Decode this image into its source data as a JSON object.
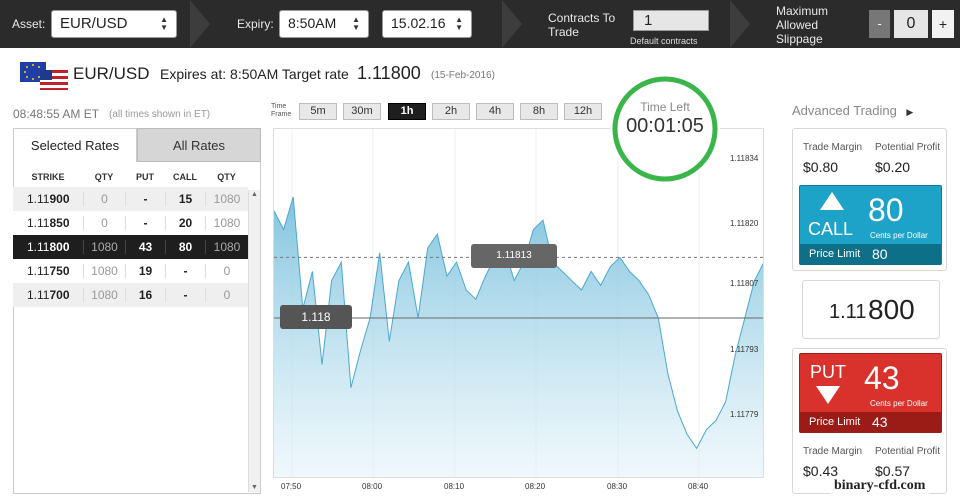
{
  "topbar": {
    "asset_label": "Asset:",
    "asset_value": "EUR/USD",
    "expiry_label": "Expiry:",
    "expiry_time": "8:50AM",
    "expiry_date": "15.02.16",
    "contracts_label_1": "Contracts To",
    "contracts_label_2": "Trade",
    "contracts_value": "1",
    "default_label": "Default contracts",
    "slippage_1": "Maximum",
    "slippage_2": "Allowed",
    "slippage_3": "Slippage",
    "minus": "-",
    "slippage_value": "0",
    "plus": "+"
  },
  "header": {
    "pair": "EUR/USD",
    "expires_text": "Expires at: 8:50AM Target rate",
    "target_rate": "1.11800",
    "date_paren": "(15-Feb-2016)",
    "clock": "08:48:55 AM ET",
    "clock_note": "(all times shown in ET)"
  },
  "timeframe": {
    "label_1": "Time",
    "label_2": "Frame",
    "buttons": [
      "5m",
      "30m",
      "1h",
      "2h",
      "4h",
      "8h",
      "12h"
    ],
    "active": "1h"
  },
  "timer": {
    "label": "Time Left",
    "value": "00:01:05"
  },
  "tabs": {
    "selected": "Selected Rates",
    "all": "All Rates"
  },
  "table": {
    "headers": [
      "STRIKE",
      "QTY",
      "PUT",
      "CALL",
      "QTY"
    ],
    "rows": [
      {
        "strike_a": "1.11",
        "strike_b": "900",
        "qty1": "0",
        "put": "-",
        "call": "15",
        "qty2": "1080"
      },
      {
        "strike_a": "1.11",
        "strike_b": "850",
        "qty1": "0",
        "put": "-",
        "call": "20",
        "qty2": "1080"
      },
      {
        "strike_a": "1.11",
        "strike_b": "800",
        "qty1": "1080",
        "put": "43",
        "call": "80",
        "qty2": "1080"
      },
      {
        "strike_a": "1.11",
        "strike_b": "750",
        "qty1": "1080",
        "put": "19",
        "call": "-",
        "qty2": "0"
      },
      {
        "strike_a": "1.11",
        "strike_b": "700",
        "qty1": "1080",
        "put": "16",
        "call": "-",
        "qty2": "0"
      }
    ]
  },
  "chart_data": {
    "type": "area",
    "x_ticks": [
      "07:50",
      "08:00",
      "08:10",
      "08:20",
      "08:30",
      "08:40"
    ],
    "y_ticks": [
      "1.11834",
      "1.11820",
      "1.11807",
      "1.11793",
      "1.11779"
    ],
    "ylim": [
      1.11768,
      1.11838
    ],
    "current_rate_label": "1.11813",
    "current_rate": 1.11813,
    "target_label": "1.118",
    "target": 1.118,
    "values": [
      1.11823,
      1.11819,
      1.11826,
      1.11802,
      1.1181,
      1.1179,
      1.11808,
      1.11812,
      1.11785,
      1.11793,
      1.118,
      1.11814,
      1.11795,
      1.11808,
      1.11812,
      1.118,
      1.11815,
      1.11818,
      1.11809,
      1.11812,
      1.11806,
      1.11804,
      1.11809,
      1.11813,
      1.11815,
      1.11808,
      1.11812,
      1.11819,
      1.11821,
      1.11812,
      1.1181,
      1.11808,
      1.11806,
      1.1181,
      1.11807,
      1.11811,
      1.11813,
      1.1181,
      1.11808,
      1.11805,
      1.118,
      1.11788,
      1.1178,
      1.11775,
      1.11772,
      1.11776,
      1.11778,
      1.11782,
      1.11792,
      1.118,
      1.11808,
      1.11812
    ]
  },
  "advanced": {
    "label": "Advanced Trading"
  },
  "call": {
    "margin_label": "Trade Margin",
    "margin": "$0.80",
    "profit_label": "Potential Profit",
    "profit": "$0.20",
    "label": "CALL",
    "price": "80",
    "cents": "Cents per Dollar",
    "limit_label": "Price Limit",
    "limit": "80"
  },
  "rate_box": {
    "prefix": "1.11",
    "big": "800"
  },
  "put": {
    "label": "PUT",
    "price": "43",
    "cents": "Cents per Dollar",
    "limit_label": "Price Limit",
    "limit": "43",
    "margin_label": "Trade Margin",
    "margin": "$0.43",
    "profit_label": "Potential Profit",
    "profit": "$0.57"
  },
  "watermark": "binary-cfd.com",
  "colors": {
    "call": "#1da3c7",
    "put": "#d9312b",
    "timer": "#39b54a",
    "active_row": "#1e1e1e"
  }
}
